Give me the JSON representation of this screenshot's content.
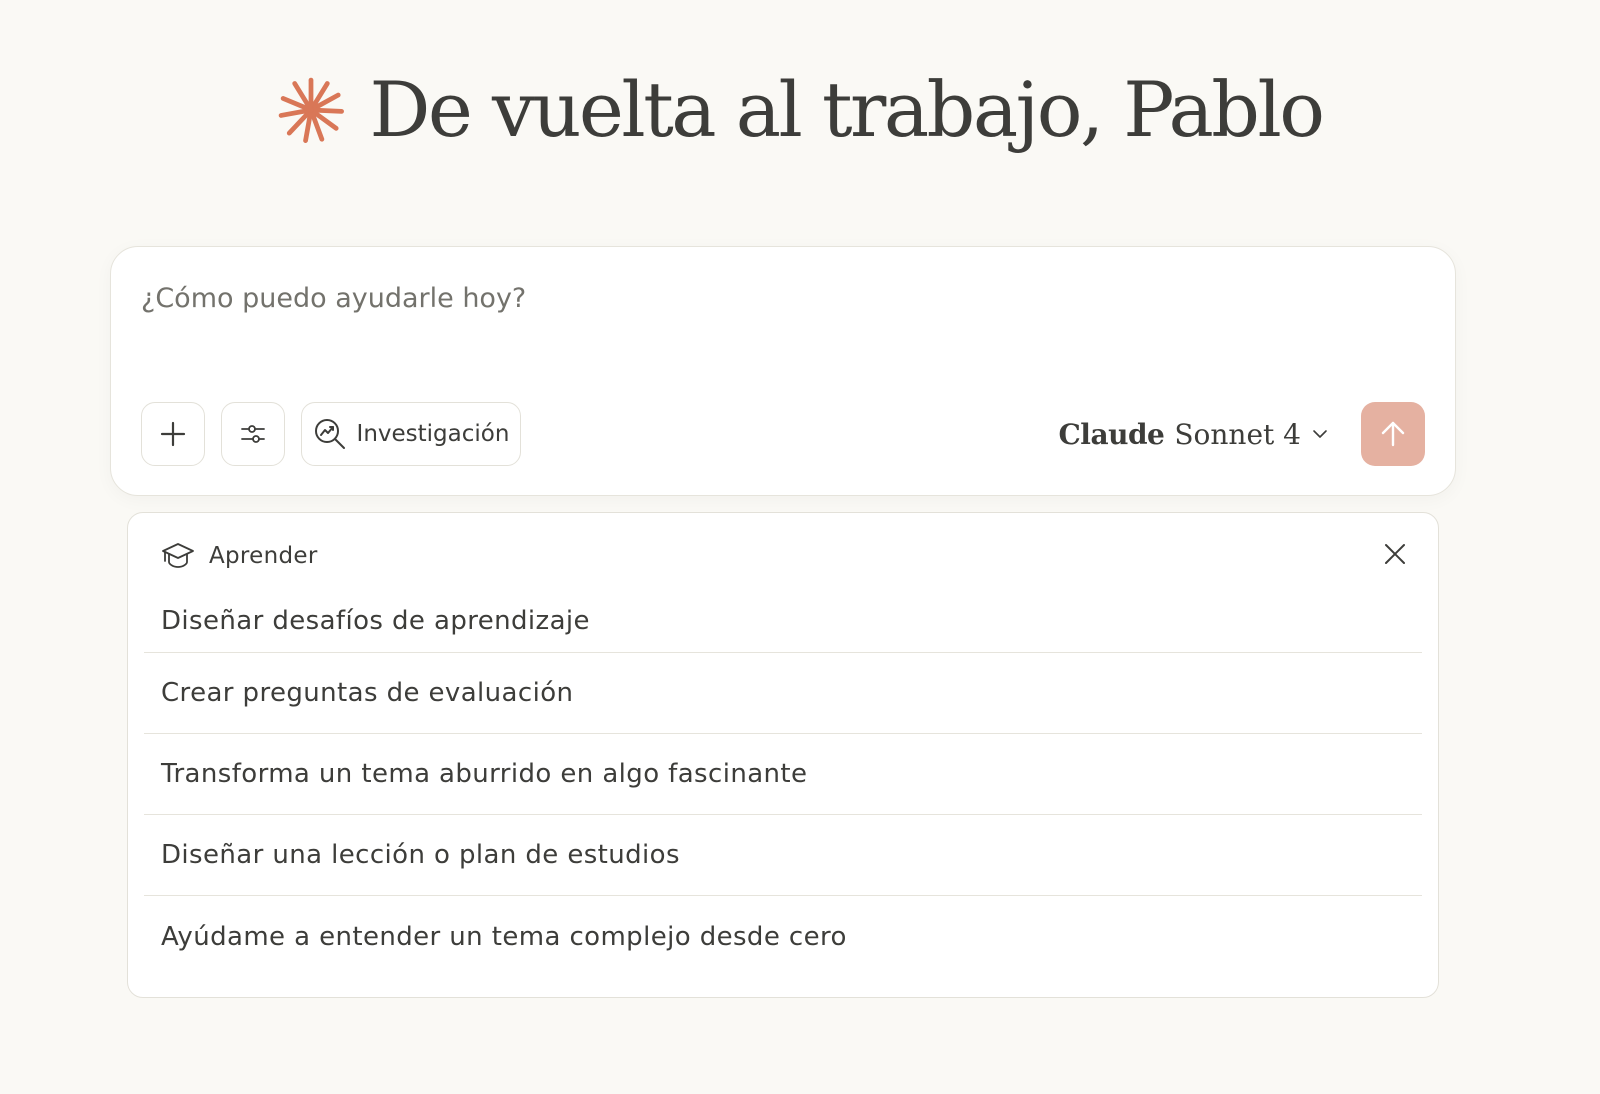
{
  "greeting": {
    "text": "De vuelta al trabajo, Pablo",
    "logo_icon": "claude-spark-icon",
    "logo_color": "#d97757"
  },
  "composer": {
    "placeholder": "¿Cómo puedo ayudarle hoy?",
    "add_icon": "plus-icon",
    "tools_icon": "sliders-icon",
    "research_icon": "research-magnifier-icon",
    "research_label": "Investigación",
    "model_brand": "Claude",
    "model_name": "Sonnet 4",
    "model_dropdown_icon": "chevron-down-icon",
    "send_icon": "arrow-up-icon",
    "send_color": "#e5b1a1"
  },
  "learn_panel": {
    "icon": "graduation-cap-icon",
    "title": "Aprender",
    "close_icon": "close-icon",
    "items": [
      "Diseñar desafíos de aprendizaje",
      "Crear preguntas de evaluación",
      "Transforma un tema aburrido en algo fascinante",
      "Diseñar una lección o plan de estudios",
      "Ayúdame a entender un tema complejo desde cero"
    ]
  }
}
